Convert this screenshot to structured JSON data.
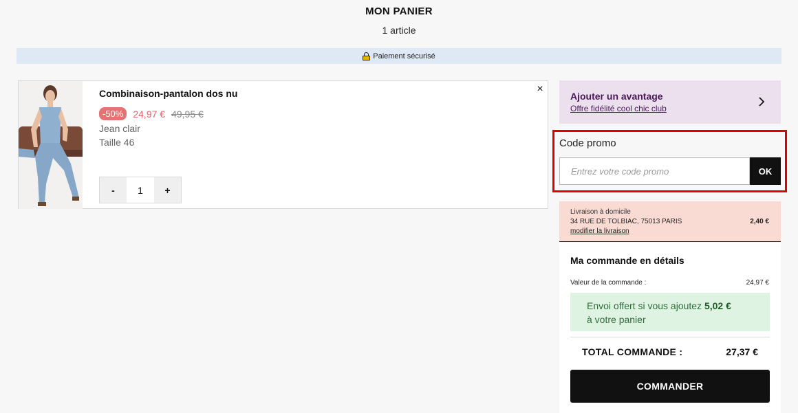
{
  "header": {
    "title": "MON PANIER",
    "subtitle": "1 article"
  },
  "secure_bar": {
    "icon": "lock-icon",
    "label": "Paiement sécurisé"
  },
  "cart": {
    "item": {
      "name": "Combinaison-pantalon dos nu",
      "discount": "-50%",
      "price": "24,97 €",
      "old_price": "49,95 €",
      "color": "Jean clair",
      "size": "Taille 46",
      "qty_minus": "-",
      "quantity": "1",
      "qty_plus": "+",
      "remove_icon": "close-icon",
      "remove_glyph": "×"
    }
  },
  "advantage": {
    "title": "Ajouter un avantage",
    "link": "Offre fidélité cool chic club",
    "icon": "chevron-right-icon"
  },
  "promo": {
    "label": "Code promo",
    "placeholder": "Entrez votre code promo",
    "value": "",
    "button": "OK"
  },
  "delivery": {
    "type": "Livraison à domicile",
    "address": "34 RUE DE TOLBIAC, 75013 PARIS",
    "modify_link": "modifier la livraison",
    "price": "2,40 €"
  },
  "order_details": {
    "title": "Ma commande en détails",
    "value_label": "Valeur de la commande :",
    "value": "24,97 €",
    "shipping_offer_prefix": "Envoi offert si vous ajoutez",
    "shipping_offer_amount": "5,02 €",
    "shipping_offer_suffix": "à votre panier",
    "total_label": "TOTAL COMMANDE :",
    "total_value": "27,37 €",
    "order_button": "COMMANDER"
  },
  "colors": {
    "accent_purple": "#4a1858",
    "discount_red": "#e57373",
    "promo_highlight": "#e10000",
    "shipping_green": "#dff3e3"
  }
}
